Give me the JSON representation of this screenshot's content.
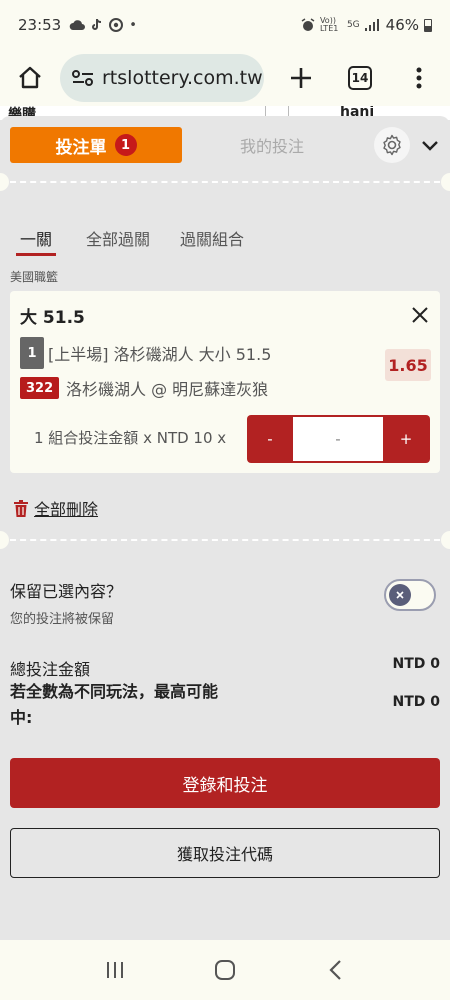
{
  "status_bar": {
    "time": "23:53",
    "battery": "46%",
    "network_label": "Vo)) LTE1",
    "signal_label": "5G"
  },
  "browser": {
    "url": "rtslottery.com.tw",
    "tab_count": "14"
  },
  "page_strip": {
    "left_fragment": "樂購",
    "right_fragment": "hani"
  },
  "betslip": {
    "tab_betslip": "投注單",
    "bet_count": "1",
    "tab_my_bets": "我的投注",
    "sub_tabs": [
      "一關",
      "全部過關",
      "過關組合"
    ],
    "league": "美國職籃",
    "selection": {
      "title": "大 51.5",
      "period_badge": "1",
      "market": "[上半場] 洛杉磯湖人 大小 51.5",
      "odds": "1.65",
      "game_id": "322",
      "match": "洛杉磯湖人 @ 明尼蘇達灰狼",
      "stake_label": "1 組合投注金額 x NTD 10 x",
      "stepper": {
        "minus": "-",
        "value": "-",
        "plus": "+"
      }
    },
    "delete_all": "全部刪除",
    "keep_selection": {
      "title": "保留已選內容？",
      "subtitle": "您的投注將被保留",
      "enabled": false
    },
    "summary": {
      "total_label": "總投注金額",
      "total_value": "NTD 0",
      "max_win_label": "若全數為不同玩法，最高可能中:",
      "max_win_value": "NTD 0"
    },
    "login_button": "登錄和投注",
    "code_button": "獲取投注代碼"
  },
  "colors": {
    "accent_orange": "#f07800",
    "brand_red": "#b22222",
    "badge_red": "#c61a1a",
    "sheet_background": "#e6e6e6",
    "card_background": "#fbfbf2"
  },
  "icons": {
    "home": "home-icon",
    "site_settings": "tune-icon",
    "new_tab": "plus-icon",
    "tabs": "tab-switcher-icon",
    "menu": "kebab-menu-icon",
    "settings": "gear-icon",
    "collapse": "chevron-down-icon",
    "remove": "close-icon",
    "delete": "trash-icon",
    "nav_recents": "recents-icon",
    "nav_home": "nav-home-icon",
    "nav_back": "back-icon"
  }
}
